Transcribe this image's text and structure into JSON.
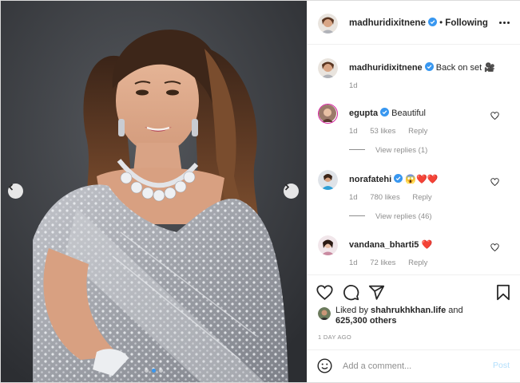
{
  "post": {
    "author": "madhuridixitnene",
    "separator": "•",
    "follow_label": "Following",
    "caption_text": "Back on set",
    "caption_emoji": "🎥",
    "caption_age": "1d",
    "photo_icon": "portrait-photo",
    "carousel": {
      "total": 3,
      "active": 1
    }
  },
  "comments": [
    {
      "user": "egupta",
      "verified": true,
      "text": "Beautiful",
      "age": "1d",
      "likes": "53 likes",
      "reply": "Reply",
      "view_replies": "View replies (1)"
    },
    {
      "user": "norafatehi",
      "verified": true,
      "text": "😱❤️❤️",
      "age": "1d",
      "likes": "780 likes",
      "reply": "Reply",
      "view_replies": "View replies (46)"
    },
    {
      "user": "vandana_bharti5",
      "verified": false,
      "text": "❤️",
      "age": "1d",
      "likes": "72 likes",
      "reply": "Reply"
    }
  ],
  "likes": {
    "prefix": "Liked by",
    "user": "shahrukhkhan.life",
    "suffix_and": "and",
    "others": "625,300 others"
  },
  "time_ago": "1 DAY AGO",
  "add_comment": {
    "placeholder": "Add a comment...",
    "post_label": "Post"
  },
  "colors": {
    "verified": "#3897f0",
    "heart": "#ed4956",
    "post_disabled": "#b2dffc",
    "muted": "#8e8e8e"
  },
  "icons": [
    "chevron-left-icon",
    "chevron-right-icon",
    "more-icon",
    "verified-icon",
    "heart-icon",
    "comment-icon",
    "share-icon",
    "bookmark-icon",
    "emoji-icon"
  ]
}
